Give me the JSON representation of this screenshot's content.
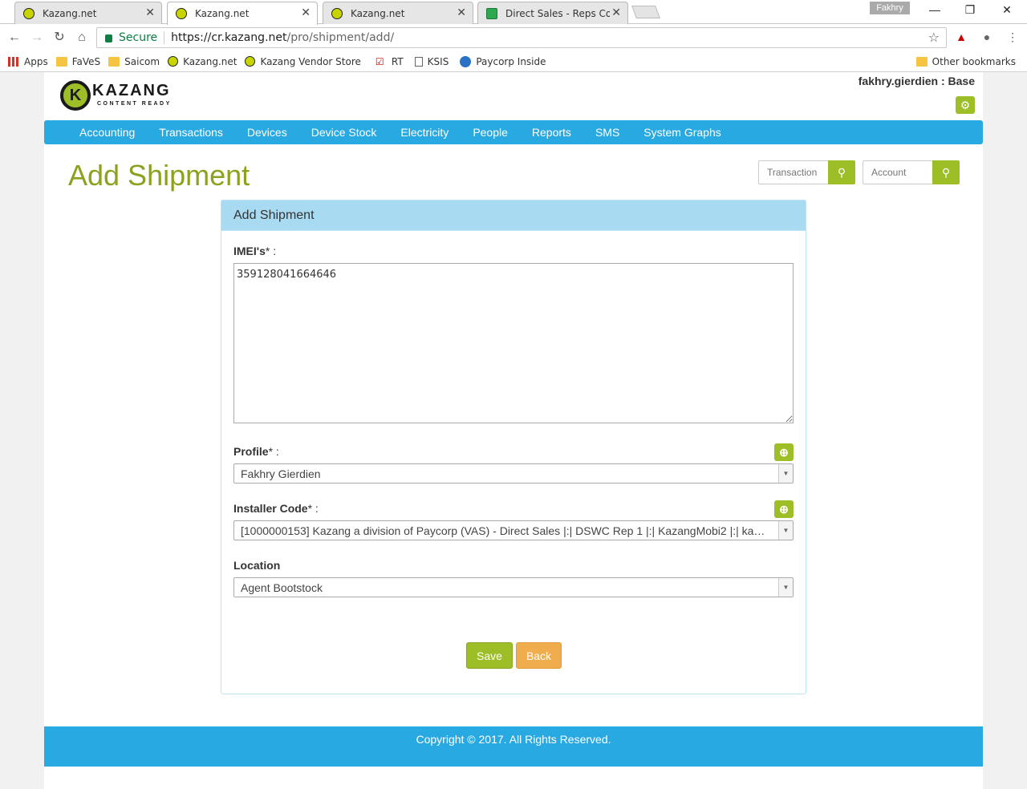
{
  "browser": {
    "tabs": [
      {
        "title": "Kazang.net",
        "icon": "kazang-favicon"
      },
      {
        "title": "Kazang.net",
        "icon": "kazang-favicon"
      },
      {
        "title": "Kazang.net",
        "icon": "kazang-favicon"
      },
      {
        "title": "Direct Sales - Reps Conta",
        "icon": "sheets-favicon"
      }
    ],
    "profile_name": "Fakhry",
    "secure_label": "Secure",
    "url_host": "https://cr.kazang.net",
    "url_path": "/pro/shipment/add/",
    "bookmarks": [
      {
        "label": "Apps",
        "icon": "apps-icon"
      },
      {
        "label": "FaVeS",
        "icon": "folder-icon"
      },
      {
        "label": "Saicom",
        "icon": "folder-icon"
      },
      {
        "label": "Kazang.net",
        "icon": "kazang-favicon"
      },
      {
        "label": "Kazang Vendor Store",
        "icon": "kazang-favicon"
      },
      {
        "label": "RT",
        "icon": "rt-icon"
      },
      {
        "label": "KSIS",
        "icon": "document-icon"
      },
      {
        "label": "Paycorp Inside",
        "icon": "globe-icon"
      }
    ],
    "other_bookmarks": "Other bookmarks"
  },
  "header": {
    "logo_word": "KAZANG",
    "logo_tagline": "CONTENT READY",
    "user": "fakhry.gierdien : Base"
  },
  "nav": {
    "items": [
      "Accounting",
      "Transactions",
      "Devices",
      "Device Stock",
      "Electricity",
      "People",
      "Reports",
      "SMS",
      "System Graphs"
    ]
  },
  "page": {
    "title": "Add Shipment",
    "search_transaction_placeholder": "Transaction",
    "search_account_placeholder": "Account"
  },
  "form": {
    "panel_title": "Add Shipment",
    "imei_label": "IMEI's",
    "imei_value": "359128041664646",
    "profile_label": "Profile",
    "profile_value": "Fakhry Gierdien",
    "installer_label": "Installer Code",
    "installer_value": "[1000000153] Kazang a division of Paycorp (VAS) - Direct Sales |:| DSWC Rep 1 |:| KazangMobi2 |:| ka…",
    "location_label": "Location",
    "location_value": "Agent Bootstock",
    "save_label": "Save",
    "back_label": "Back"
  },
  "footer": {
    "copyright": "Copyright © 2017. All Rights Reserved."
  },
  "colors": {
    "brand_green": "#9dbe26",
    "title_green": "#8aa21f",
    "nav_blue": "#29a9e1",
    "panel_head": "#a8daf2",
    "back_orange": "#f0ad4e"
  }
}
